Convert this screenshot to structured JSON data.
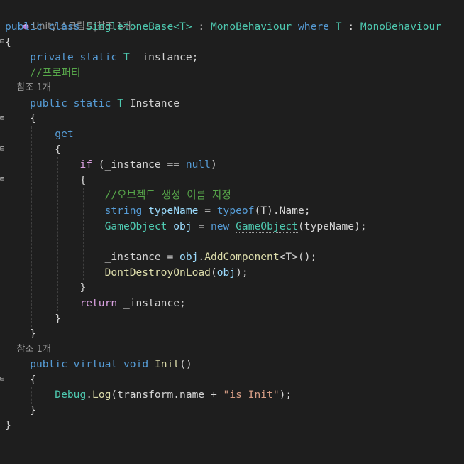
{
  "lens": {
    "unity_label": "Unity 스크립트|참조 1개",
    "refs": "참조 1개"
  },
  "tokens": {
    "public": "public",
    "class": "class",
    "class_name": "SingletoneBase<T>",
    "colon": " : ",
    "base": "MonoBehaviour",
    "where": "where",
    "T": "T",
    "private": "private",
    "static": "static",
    "field": "_instance;",
    "comment_property": "//프로퍼티",
    "Instance": "Instance",
    "get": "get",
    "if": "if",
    "if_open": " (_instance == ",
    "null": "null",
    "close_paren": ")",
    "comment_name": "//오브젝트 생성 이름 지정",
    "string": "string",
    "typeName": "typeName",
    "eq": " = ",
    "typeof": "typeof",
    "typeof_rest": "(T).Name;",
    "GameObject": "GameObject",
    "obj": "obj",
    "new": "new",
    "new_args": "(typeName);",
    "instance_assign": "_instance = ",
    "obj_dot": "obj.",
    "AddComponent": "AddComponent",
    "generic_T": "<T>();",
    "DontDestroyOnLoad": "DontDestroyOnLoad",
    "ddol_args": "(obj);",
    "return": "return",
    "return_val": " _instance;",
    "virtual": "virtual",
    "void": "void",
    "Init": "Init",
    "init_parens": "()",
    "Debug": "Debug",
    "Log": "Log",
    "log_open": "(transform.name + ",
    "log_str": "\"is Init\"",
    "log_close": ");",
    "brace_open": "{",
    "brace_close": "}"
  },
  "colors": {
    "background": "#1e1e1e",
    "keyword": "#569cd6",
    "control": "#d8a0df",
    "type": "#4ec9b0",
    "identifier": "#9cdcfe",
    "method": "#dcdcaa",
    "string": "#d69d85",
    "comment": "#57a64a"
  },
  "icons": {
    "unity": "unity-cube-icon",
    "fold": "fold-toggle-icon"
  }
}
